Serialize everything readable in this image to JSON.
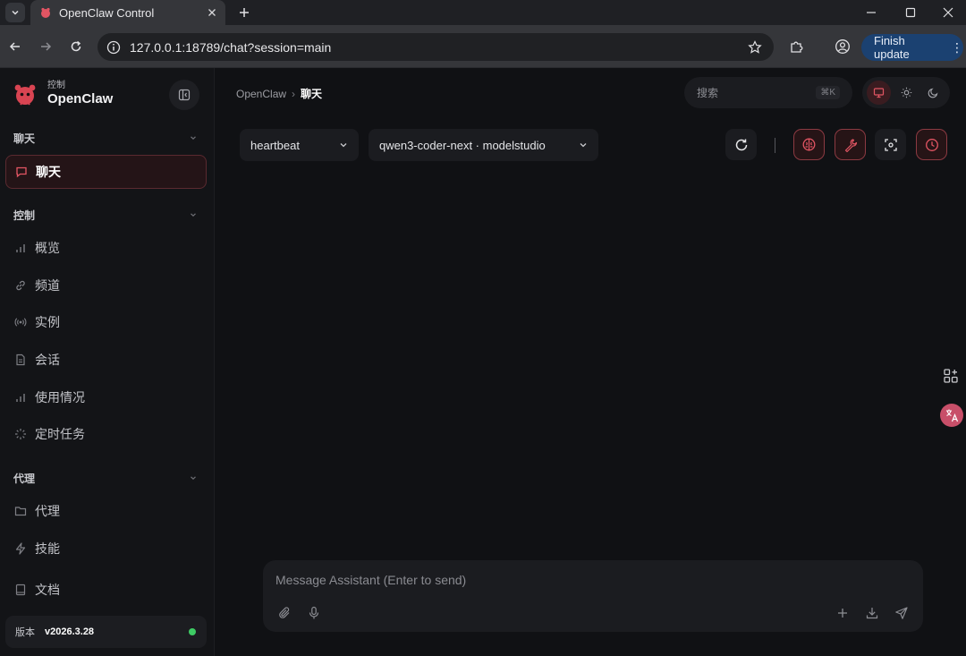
{
  "browser": {
    "tab_title": "OpenClaw Control",
    "url": "127.0.0.1:18789/chat?session=main",
    "finish_update_label": "Finish update"
  },
  "sidebar": {
    "brand_subtitle": "控制",
    "brand_name": "OpenClaw",
    "sections": [
      {
        "label": "聊天",
        "items": [
          {
            "label": "聊天",
            "icon": "message-icon",
            "active": true
          }
        ]
      },
      {
        "label": "控制",
        "items": [
          {
            "label": "概览",
            "icon": "bar-chart-icon"
          },
          {
            "label": "频道",
            "icon": "link-icon"
          },
          {
            "label": "实例",
            "icon": "radio-icon"
          },
          {
            "label": "会话",
            "icon": "document-icon"
          },
          {
            "label": "使用情况",
            "icon": "bar-chart-icon"
          },
          {
            "label": "定时任务",
            "icon": "loader-icon"
          }
        ]
      },
      {
        "label": "代理",
        "items": [
          {
            "label": "代理",
            "icon": "folder-icon"
          },
          {
            "label": "技能",
            "icon": "zap-icon"
          },
          {
            "label": "文档",
            "icon": "book-icon"
          }
        ]
      }
    ],
    "version_label": "版本",
    "version_value": "v2026.3.28",
    "status_color": "#3ecb64"
  },
  "header": {
    "breadcrumb_root": "OpenClaw",
    "breadcrumb_separator": "›",
    "breadcrumb_current": "聊天",
    "search_placeholder": "搜索",
    "search_shortcut": "⌘K",
    "theme_modes": [
      "monitor-icon",
      "sun-icon",
      "moon-icon"
    ],
    "active_theme": "system"
  },
  "chat": {
    "session_select": "heartbeat",
    "model_select": "qwen3-coder-next · modelstudio",
    "actions": [
      "refresh-icon",
      "brain-icon",
      "wrench-icon",
      "focus-icon",
      "clock-icon"
    ],
    "composer_placeholder": "Message Assistant (Enter to send)"
  },
  "colors": {
    "accent": "#e25563",
    "background": "#101114",
    "sidebar": "#131417",
    "active_nav_bg": "#241417",
    "finish_update_bg": "#1b4171"
  }
}
